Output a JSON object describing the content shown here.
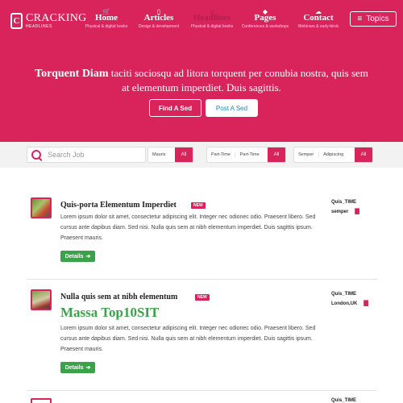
{
  "brand": {
    "badge": "C",
    "name": "CRACKING",
    "tagline": "HEADLINES"
  },
  "nav": [
    {
      "icon": "🛒",
      "icon_name": "cart-icon",
      "title": "Home",
      "sub": "Physical & digital books"
    },
    {
      "icon": "▯",
      "icon_name": "phone-icon",
      "title": "Articles",
      "sub": "Design & development"
    },
    {
      "icon": "♕",
      "icon_name": "crown-icon",
      "title": "Headlines",
      "sub": "Physical & digital books",
      "active": true
    },
    {
      "icon": "◆",
      "icon_name": "diamond-icon",
      "title": "Pages",
      "sub": "Conferences & workshops"
    },
    {
      "icon": "☁",
      "icon_name": "cloud-icon",
      "title": "Contact",
      "sub": "Webinars & early-birds"
    }
  ],
  "topics_button": {
    "icon": "≡",
    "label": "Topics"
  },
  "hero": {
    "headline_bold": "Torquent Diam",
    "headline_rest": " taciti sociosqu ad litora torquent per conubia nostra, quis sem at elementum imperdiet. Duis sagittis.",
    "find_label": "Find A Sed",
    "post_label": "Post A Sed"
  },
  "search": {
    "placeholder": "Search Job",
    "filter1": {
      "options": [
        "Mauris"
      ],
      "all_label": "All"
    },
    "filter2": {
      "options": [
        "Part-Time",
        "Part-Time"
      ],
      "all_label": "All"
    },
    "filter3": {
      "options": [
        "Semper",
        "Adipiscing"
      ],
      "all_label": "All"
    }
  },
  "listings": [
    {
      "title": "Quis-porta Elementum Imperdiet",
      "badge": "NEW",
      "description": "Lorem ipsum dolor sit amet, consectetur adipiscing elit. Integer nec odionec odio. Praesent libero. Sed cursus ante dapibus diam. Sed nisi. Nulla quis sem at nibh elementum imperdiet. Duis sagittis ipsum. Praesent mauris.",
      "details_label": "Details",
      "meta_top": "Quis_TIME",
      "meta_location": "semper"
    },
    {
      "title": "Nulla quis sem at nibh elementum",
      "badge": "NEW",
      "highlight": "Massa Top10SIT",
      "description": "Lorem ipsum dolor sit amet, consectetur adipiscing elit. Integer nec odionec odio. Praesent libero. Sed cursus ante dapibus diam. Sed nisi. Nulla quis sem at nibh elementum imperdiet. Duis sagittis ipsum. Praesent mauris.",
      "details_label": "Details",
      "meta_top": "Quis_TIME",
      "meta_location": "London,UK"
    }
  ],
  "partial_meta": "Quis_TIME",
  "colors": {
    "brand": "#d8245b",
    "green": "#3aa34a",
    "link": "#1e8ab8"
  }
}
